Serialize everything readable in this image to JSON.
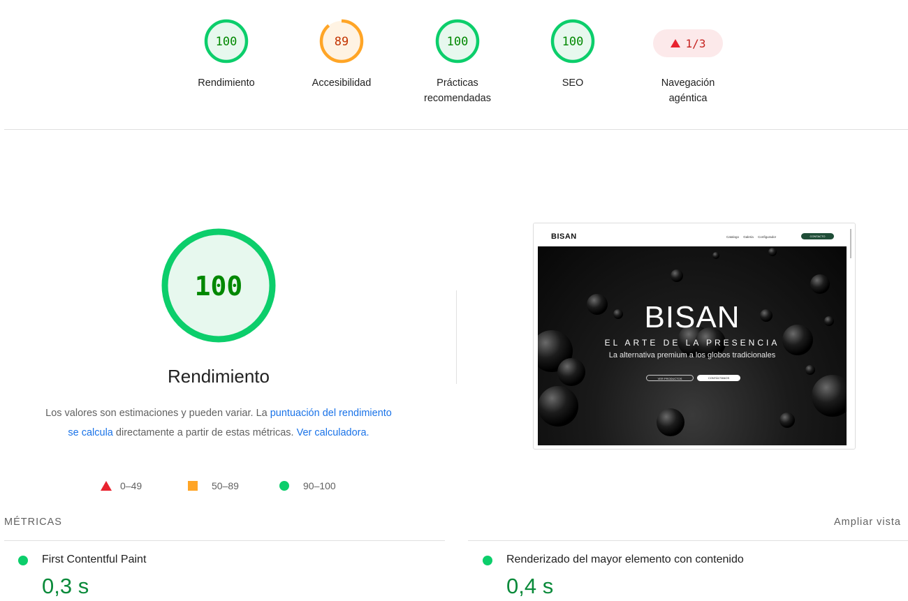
{
  "categories": [
    {
      "score": "100",
      "label": "Rendimiento",
      "fraction": 1.0,
      "status": "pass"
    },
    {
      "score": "89",
      "label": "Accesibilidad",
      "fraction": 0.89,
      "status": "average"
    },
    {
      "score": "100",
      "label_line1": "Prácticas",
      "label_line2": "recomendadas",
      "fraction": 1.0,
      "status": "pass"
    },
    {
      "score": "100",
      "label": "SEO",
      "fraction": 1.0,
      "status": "pass"
    }
  ],
  "agentic": {
    "value": "1/3",
    "label_line1": "Navegación",
    "label_line2": "agéntica",
    "status": "fail"
  },
  "performance": {
    "score": "100",
    "fraction": 1.0,
    "title": "Rendimiento",
    "desc_part1": "Los valores son estimaciones y pueden variar. La ",
    "desc_link1": "puntuación del rendimiento se calcula",
    "desc_part2": " directamente a partir de estas métricas. ",
    "desc_link2": "Ver calculadora."
  },
  "legend": {
    "fail": "0–49",
    "average": "50–89",
    "pass": "90–100"
  },
  "screenshot": {
    "nav_logo": "BISAN",
    "nav_links": [
      "Catalogo",
      "Galeria",
      "Configurador"
    ],
    "nav_cta": "CONTACTO",
    "hero_title": "BISAN",
    "hero_subtitle": "EL ARTE DE LA PRESENCIA",
    "hero_tagline": "La alternativa premium a los globos tradicionales",
    "btn_products": "VER PRODUCTOS",
    "btn_contact": "CONTÁCTANOS"
  },
  "metrics": {
    "heading": "MÉTRICAS",
    "expand": "Ampliar vista",
    "items": [
      {
        "name": "First Contentful Paint",
        "value": "0,3 s",
        "status": "pass"
      },
      {
        "name": "Renderizado del mayor elemento con contenido",
        "value": "0,4 s",
        "status": "pass"
      }
    ]
  },
  "colors": {
    "pass": "#0cce6b",
    "pass_bg": "#e7f8ee",
    "pass_text": "#008800",
    "average": "#ffa526",
    "average_bg": "#fff3e3",
    "average_text": "#c33300",
    "fail": "#e8232f",
    "fail_bg": "#fce9ea",
    "link": "#1a73e8"
  }
}
